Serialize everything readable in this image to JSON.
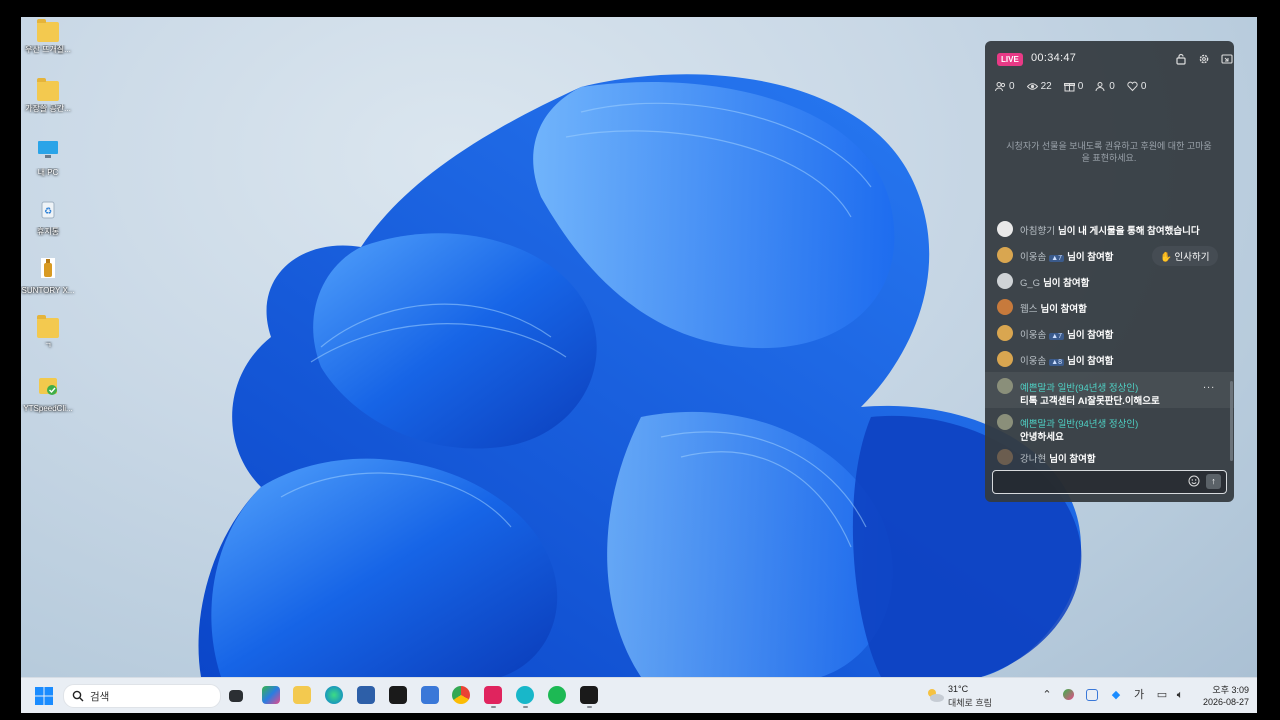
{
  "desktop": {
    "icons": [
      {
        "label": "우산 뜨개질...",
        "icon": "folder-icon"
      },
      {
        "label": "가장쓸 공간...",
        "icon": "user-folder-icon"
      },
      {
        "label": "내 PC",
        "icon": "monitor-icon"
      },
      {
        "label": "휴지통",
        "icon": "recycle-bin-icon"
      },
      {
        "label": "SUNTORY X...",
        "icon": "bottle-icon"
      },
      {
        "label": "ㄱ",
        "icon": "folder-icon"
      },
      {
        "label": "YTSpeedCli...",
        "icon": "app-icon"
      }
    ]
  },
  "live_panel": {
    "badge": "LIVE",
    "timer": "00:34:47",
    "stats": {
      "followers": "0",
      "viewers": "22",
      "gifts": "0",
      "joins": "0",
      "likes": "0"
    },
    "hint": "시청자가 선물을 보내도록 권유하고 후원에 대한 고마움을 표현하세요.",
    "greet_button": "인사하기",
    "messages": [
      {
        "user": "아침향기",
        "level": "",
        "action": "님이 내 게시물을 통해 참여했습니다"
      },
      {
        "user": "이웅솜",
        "level": "7",
        "action": "님이 참여함"
      },
      {
        "user": "G_G",
        "level": "",
        "action": "님이 참여함"
      },
      {
        "user": "웹스",
        "level": "",
        "action": "님이 참여함"
      },
      {
        "user": "이웅솜",
        "level": "7",
        "action": "님이 참여함"
      },
      {
        "user": "이웅솜",
        "level": "8",
        "action": "님이 참여함"
      }
    ],
    "comments": [
      {
        "user": "예쁜말과 일반(94년생 정상인)",
        "text": "티톡 고객센터 AI잘못판단.이해으로"
      },
      {
        "user": "예쁜말과 일반(94년생 정상인)",
        "text": "안녕하세요"
      }
    ],
    "last_join": {
      "user": "강나현",
      "action": "님이 참여함"
    },
    "more": "...",
    "input_value": "",
    "send": "↑"
  },
  "taskbar": {
    "search_placeholder": "검색",
    "weather_temp": "31°C",
    "weather_desc": "대체로 흐림",
    "ime": "가",
    "time": "오후 3:09",
    "date": "2026-08-27"
  }
}
